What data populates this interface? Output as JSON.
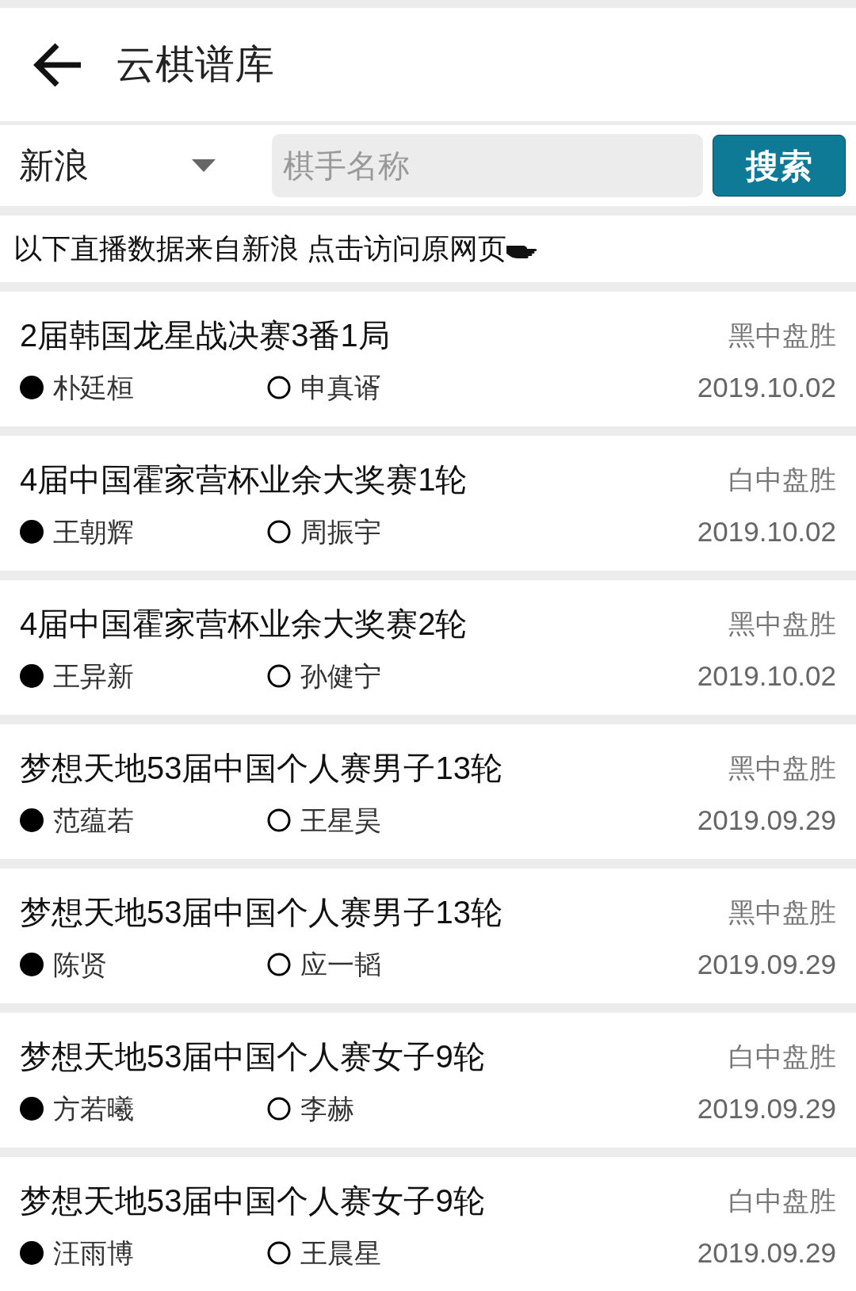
{
  "header": {
    "title": "云棋谱库"
  },
  "search": {
    "source": "新浪",
    "placeholder": "棋手名称",
    "button": "搜索"
  },
  "notice": "以下直播数据来自新浪 点击访问原网页",
  "games": [
    {
      "title": "2届韩国龙星战决赛3番1局",
      "result": "黑中盘胜",
      "black": "朴廷桓",
      "white": "申真谞",
      "date": "2019.10.02"
    },
    {
      "title": "4届中国霍家营杯业余大奖赛1轮",
      "result": "白中盘胜",
      "black": "王朝辉",
      "white": "周振宇",
      "date": "2019.10.02"
    },
    {
      "title": "4届中国霍家营杯业余大奖赛2轮",
      "result": "黑中盘胜",
      "black": "王异新",
      "white": "孙健宁",
      "date": "2019.10.02"
    },
    {
      "title": "梦想天地53届中国个人赛男子13轮",
      "result": "黑中盘胜",
      "black": "范蕴若",
      "white": "王星昊",
      "date": "2019.09.29"
    },
    {
      "title": "梦想天地53届中国个人赛男子13轮",
      "result": "黑中盘胜",
      "black": "陈贤",
      "white": "应一韬",
      "date": "2019.09.29"
    },
    {
      "title": "梦想天地53届中国个人赛女子9轮",
      "result": "白中盘胜",
      "black": "方若曦",
      "white": "李赫",
      "date": "2019.09.29"
    },
    {
      "title": "梦想天地53届中国个人赛女子9轮",
      "result": "白中盘胜",
      "black": "汪雨博",
      "white": "王晨星",
      "date": "2019.09.29"
    }
  ]
}
